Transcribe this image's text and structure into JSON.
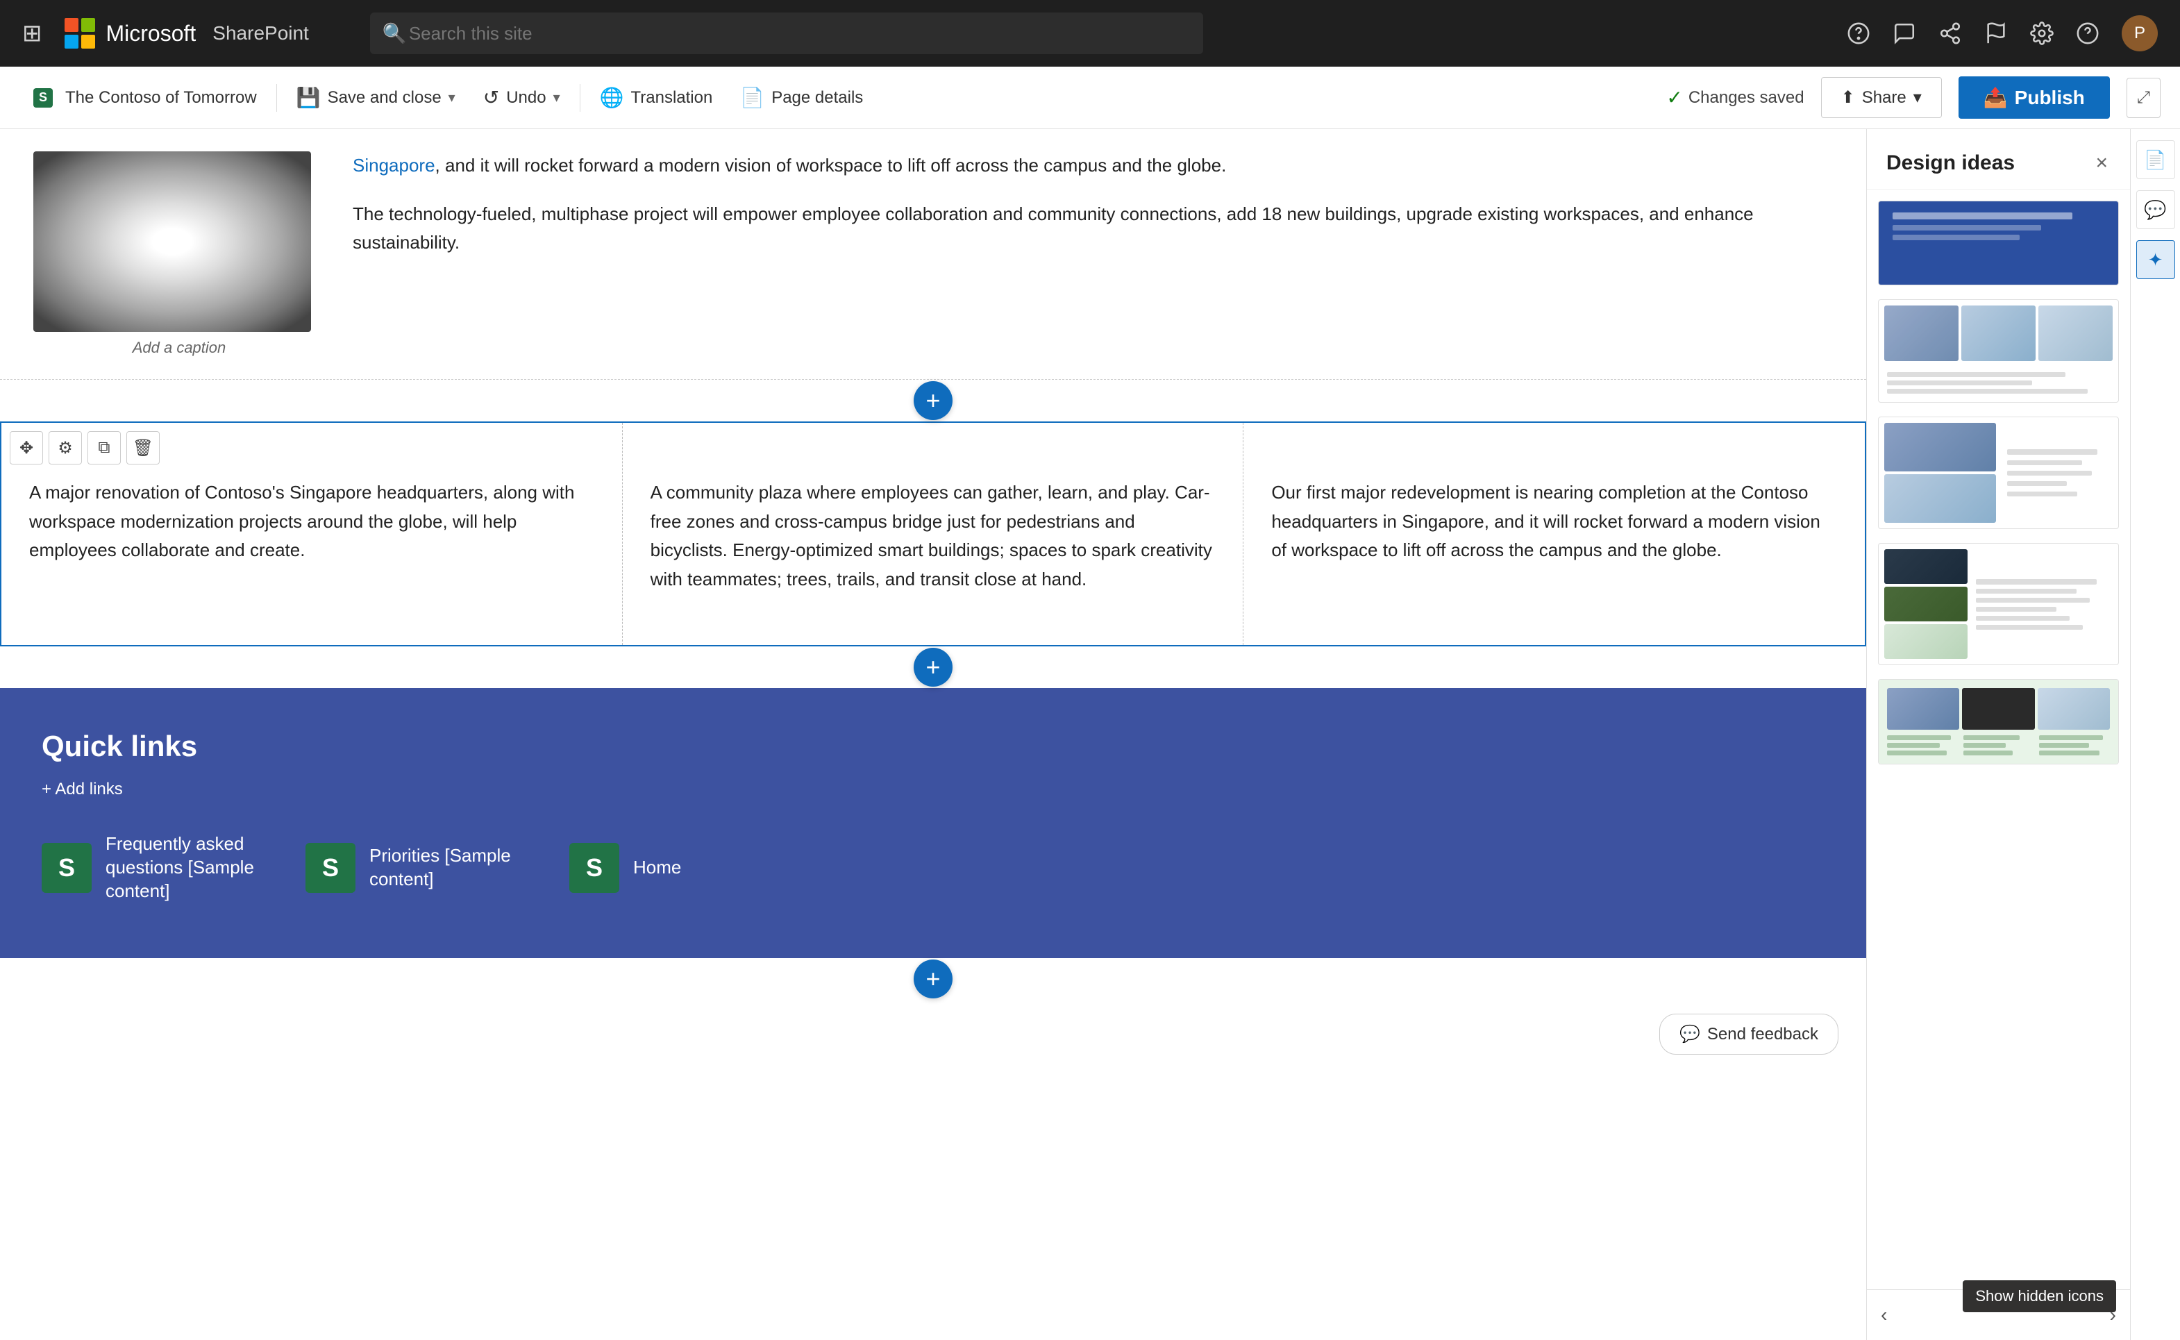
{
  "app": {
    "waffle_label": "⊞",
    "logo_colors": [
      "#f35325",
      "#81bc06",
      "#05a6f0",
      "#ffba08"
    ],
    "app_name": "Microsoft",
    "sharepoint_name": "SharePoint"
  },
  "search": {
    "placeholder": "Search this site"
  },
  "nav_icons": {
    "help_icon": "?",
    "feedback_icon": "💬",
    "share_icon": "🔗",
    "flag_icon": "⚑",
    "settings_icon": "⚙",
    "question_icon": "?"
  },
  "second_toolbar": {
    "site_label": "The Contoso of Tomorrow",
    "save_close_label": "Save and close",
    "undo_label": "Undo",
    "translation_label": "Translation",
    "page_details_label": "Page details",
    "changes_saved_label": "Changes saved",
    "share_label": "Share",
    "publish_label": "Publish"
  },
  "article": {
    "image_caption": "Add a caption",
    "para1": "Singapore, and it will rocket forward a modern vision of workspace to lift off across the campus and the globe.",
    "para2": "The technology-fueled, multiphase project will empower employee collaboration and community connections, add 18 new buildings, upgrade existing workspaces, and enhance sustainability."
  },
  "three_columns": {
    "col1": "A major renovation of Contoso's Singapore headquarters, along with workspace modernization projects around the globe, will help employees collaborate and create.",
    "col2": "A community plaza where employees can gather, learn, and play. Car-free zones and cross-campus bridge just for pedestrians and bicyclists. Energy-optimized smart buildings; spaces to spark creativity with teammates; trees, trails, and transit close at hand.",
    "col3": "Our first major redevelopment is nearing completion at the Contoso headquarters in Singapore, and it will rocket forward a modern vision of workspace to lift off across the campus and the globe."
  },
  "quick_links": {
    "title": "Quick links",
    "add_links_label": "+ Add links",
    "links": [
      {
        "label": "Frequently asked questions [Sample content]",
        "icon": "S"
      },
      {
        "label": "Priorities [Sample content]",
        "icon": "S"
      },
      {
        "label": "Home",
        "icon": "S"
      }
    ]
  },
  "feedback": {
    "label": "Send feedback"
  },
  "design_panel": {
    "title": "Design ideas",
    "close_label": "×",
    "show_hidden_label": "Show hidden icons"
  }
}
